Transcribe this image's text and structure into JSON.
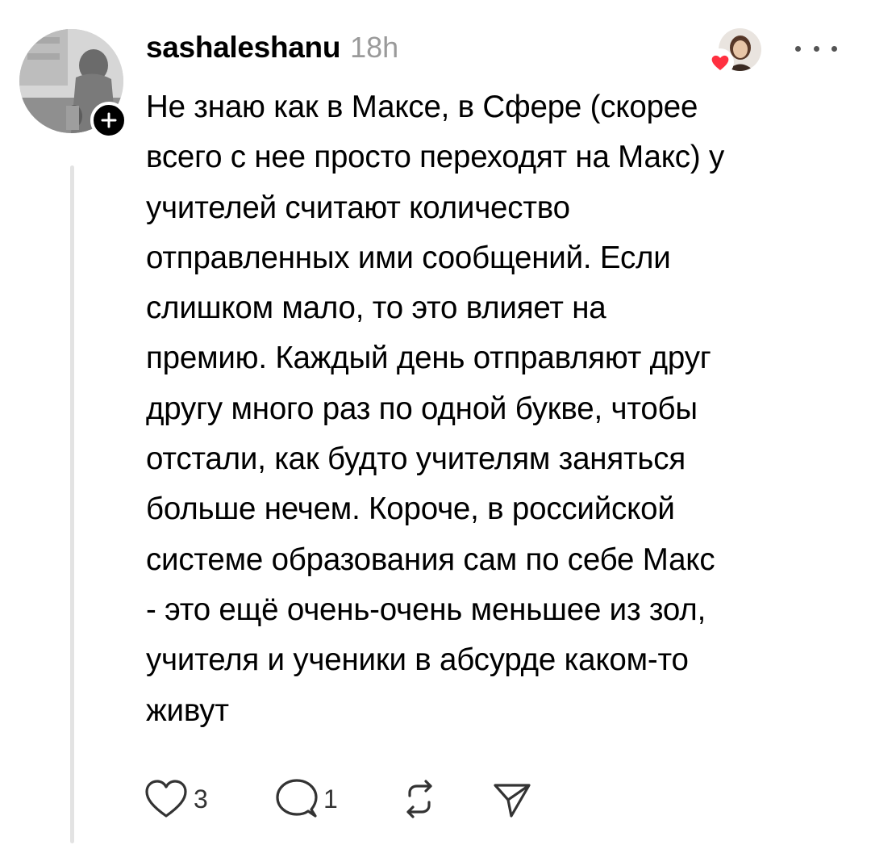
{
  "post": {
    "author": {
      "username": "sashaleshanu",
      "avatar_icon": "profile-photo",
      "follow_icon": "plus-icon"
    },
    "timestamp": "18h",
    "liked_by_icon": "heart-icon",
    "more_icon": "more-horizontal-icon",
    "text": "Не знаю как в Максе, в Сфере (скорее\nвсего с нее просто переходят на Макс) у\nучителей считают количество\nотправленных ими сообщений. Если\nслишком мало, то это влияет на\nпремию. Каждый день отправляют друг\nдругу много раз по одной букве, чтобы\nотстали, как будто учителям заняться\nбольше нечем. Короче, в российской\nсистеме образования сам по себе Макс\n- это ещё очень-очень меньшее из зол,\nучителя и ученики в абсурде каком-то\nживут",
    "actions": {
      "like": {
        "icon": "heart-outline-icon",
        "count": "3"
      },
      "reply": {
        "icon": "comment-icon",
        "count": "1"
      },
      "repost": {
        "icon": "repost-icon"
      },
      "share": {
        "icon": "send-icon"
      }
    }
  },
  "colors": {
    "text": "#000000",
    "muted": "#9a9a9a",
    "heart_badge": "#ff3040",
    "thread_line": "#e3e3e3"
  }
}
